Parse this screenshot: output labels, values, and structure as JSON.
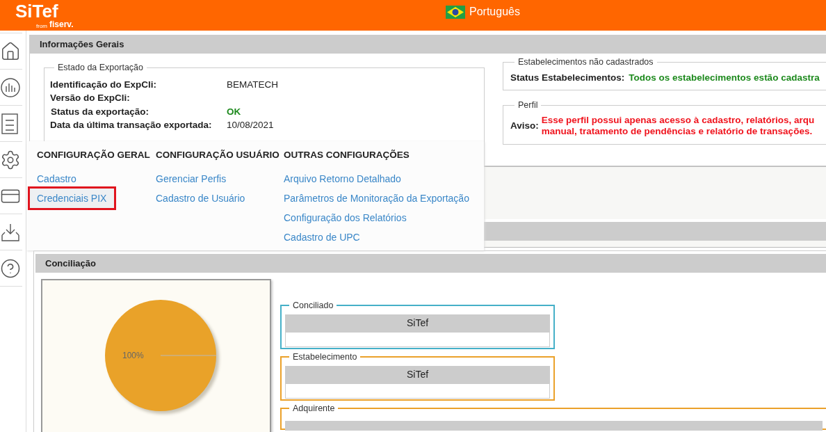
{
  "header": {
    "logo": "SiTef",
    "logo_from": "from",
    "logo_brand": "fiserv.",
    "language": "Português"
  },
  "informacoes_gerais": {
    "title": "Informações Gerais",
    "estado_exportacao": {
      "legend": "Estado da Exportação",
      "rows": [
        {
          "label": "Identificação do ExpCli:",
          "value": "BEMATECH",
          "kind": "plain"
        },
        {
          "label": "Versão do ExpCli:",
          "kind": "plain"
        },
        {
          "label": "Status da exportação:",
          "value": "OK",
          "kind": "status"
        },
        {
          "label": "Data da última transação exportada:",
          "value": "10/08/2021",
          "kind": "plain"
        }
      ]
    },
    "estabelecimentos": {
      "legend": "Estabelecimentos não cadastrados",
      "label": "Status Estabelecimentos:",
      "value": "Todos os estabelecimentos estão cadastra"
    },
    "perfil": {
      "legend": "Perfil",
      "label": "Aviso:",
      "value_lines": [
        "Esse perfil possui apenas acesso à cadastro, relatórios, arqu",
        "manual, tratamento de pendências e relatório de transações."
      ]
    }
  },
  "menu": {
    "columns": [
      {
        "heading": "CONFIGURAÇÃO GERAL",
        "items": [
          {
            "label": "Cadastro",
            "highlighted": false
          },
          {
            "label": "Credenciais PIX",
            "highlighted": true
          }
        ]
      },
      {
        "heading": "CONFIGURAÇÃO USUÁRIO",
        "items": [
          {
            "label": "Gerenciar Perfis",
            "highlighted": false
          },
          {
            "label": "Cadastro de Usuário",
            "highlighted": false
          }
        ]
      },
      {
        "heading": "OUTRAS CONFIGURAÇÕES",
        "items": [
          {
            "label": "Arquivo Retorno Detalhado",
            "highlighted": false
          },
          {
            "label": "Parâmetros de Monitoração da Exportação",
            "highlighted": false
          },
          {
            "label": "Configuração dos Relatórios",
            "highlighted": false
          },
          {
            "label": "Cadastro de UPC",
            "highlighted": false
          }
        ]
      }
    ]
  },
  "conciliacao": {
    "title": "Conciliação",
    "pie_label": "100%",
    "groups": [
      {
        "legend": "Conciliado",
        "color": "#45b0c8",
        "table_header": "SiTef"
      },
      {
        "legend": "Estabelecimento",
        "color": "#eba12a",
        "table_header": "SiTef"
      },
      {
        "legend": "Adquirente",
        "color": "#eba12a"
      }
    ]
  }
}
